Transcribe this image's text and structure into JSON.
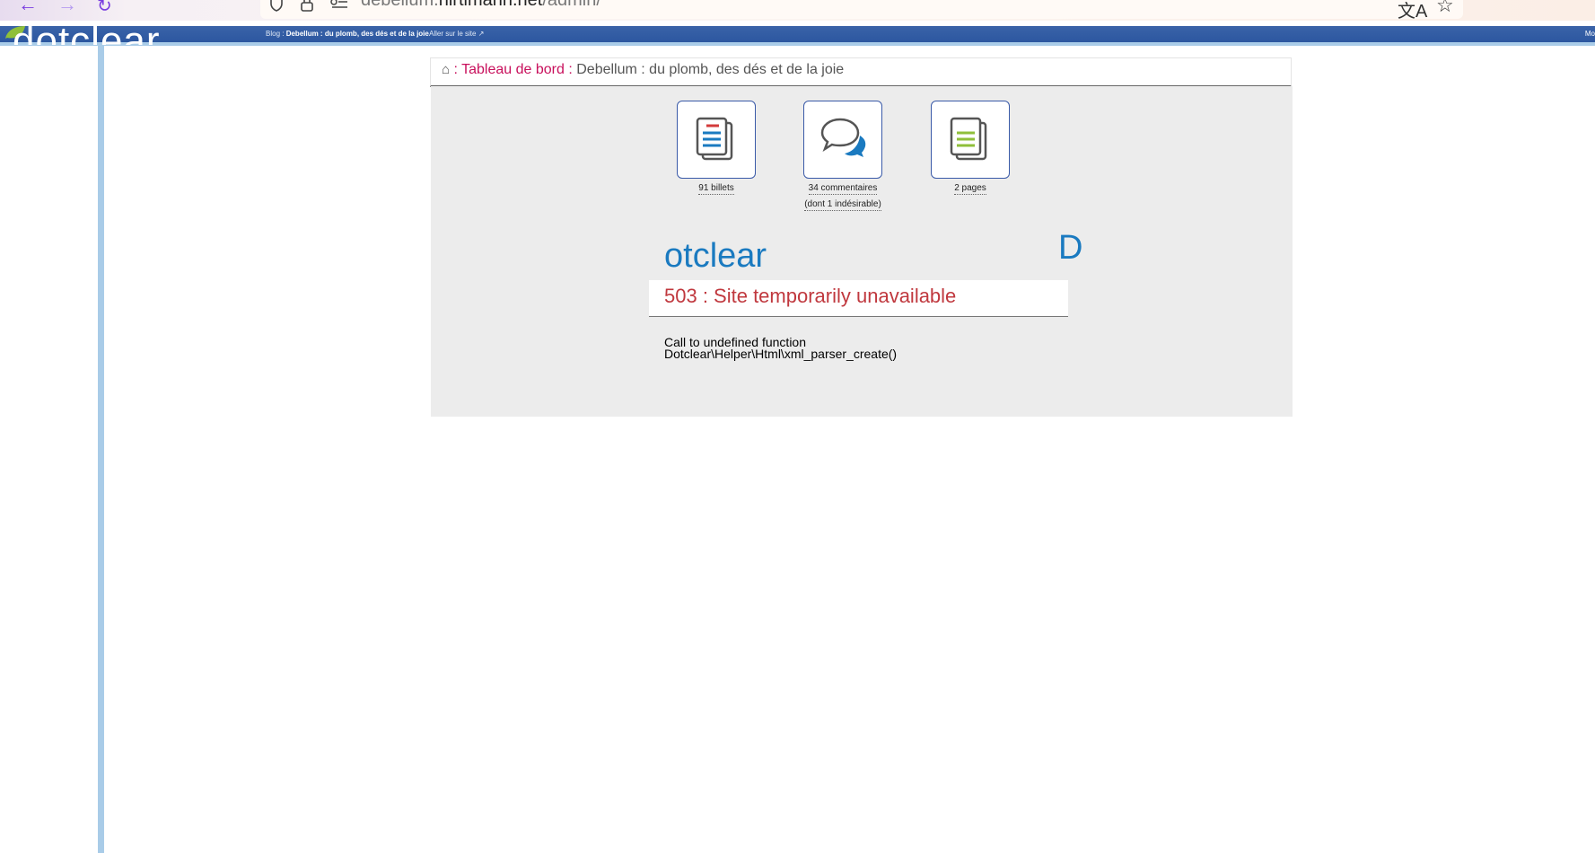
{
  "browser": {
    "url_domain_prefix": "debellum.",
    "url_domain_main": "hirtimann.net",
    "url_path": "/admin/",
    "icons": [
      "back-arrow-icon",
      "forward-arrow-icon",
      "reload-icon",
      "shield-icon",
      "lock-icon",
      "permissions-icon",
      "translate-icon",
      "star-icon"
    ]
  },
  "topbar": {
    "blog_prefix": "Blog :",
    "blog_name": "Debellum : du plomb, des dés et de la joie",
    "visit_label": "Aller sur le site",
    "my_label": "Mo",
    "logo_text": "dotclear",
    "colors": {
      "bar": "#2c57a0",
      "accent_line": "#a9cce8"
    }
  },
  "breadcrumb": {
    "sep1": ":",
    "link": "Tableau de bord",
    "sep2": ":",
    "current": "Debellum : du plomb, des dés et de la joie"
  },
  "shortcuts": [
    {
      "label": "91 billets",
      "icon": "posts-icon"
    },
    {
      "label": "34 commentaires",
      "sub": "(dont 1 indésirable)",
      "icon": "comments-icon"
    },
    {
      "label": "2 pages",
      "icon": "pages-icon"
    }
  ],
  "error": {
    "brand": "otclear",
    "brand_initial": "D",
    "title": "503 : Site temporarily unavailable",
    "message_line1": "Call to undefined function",
    "message_line2": "Dotclear\\Helper\\Html\\xml_parser_create()",
    "colors": {
      "brand": "#1a7ac0",
      "title": "#c0383e"
    }
  }
}
